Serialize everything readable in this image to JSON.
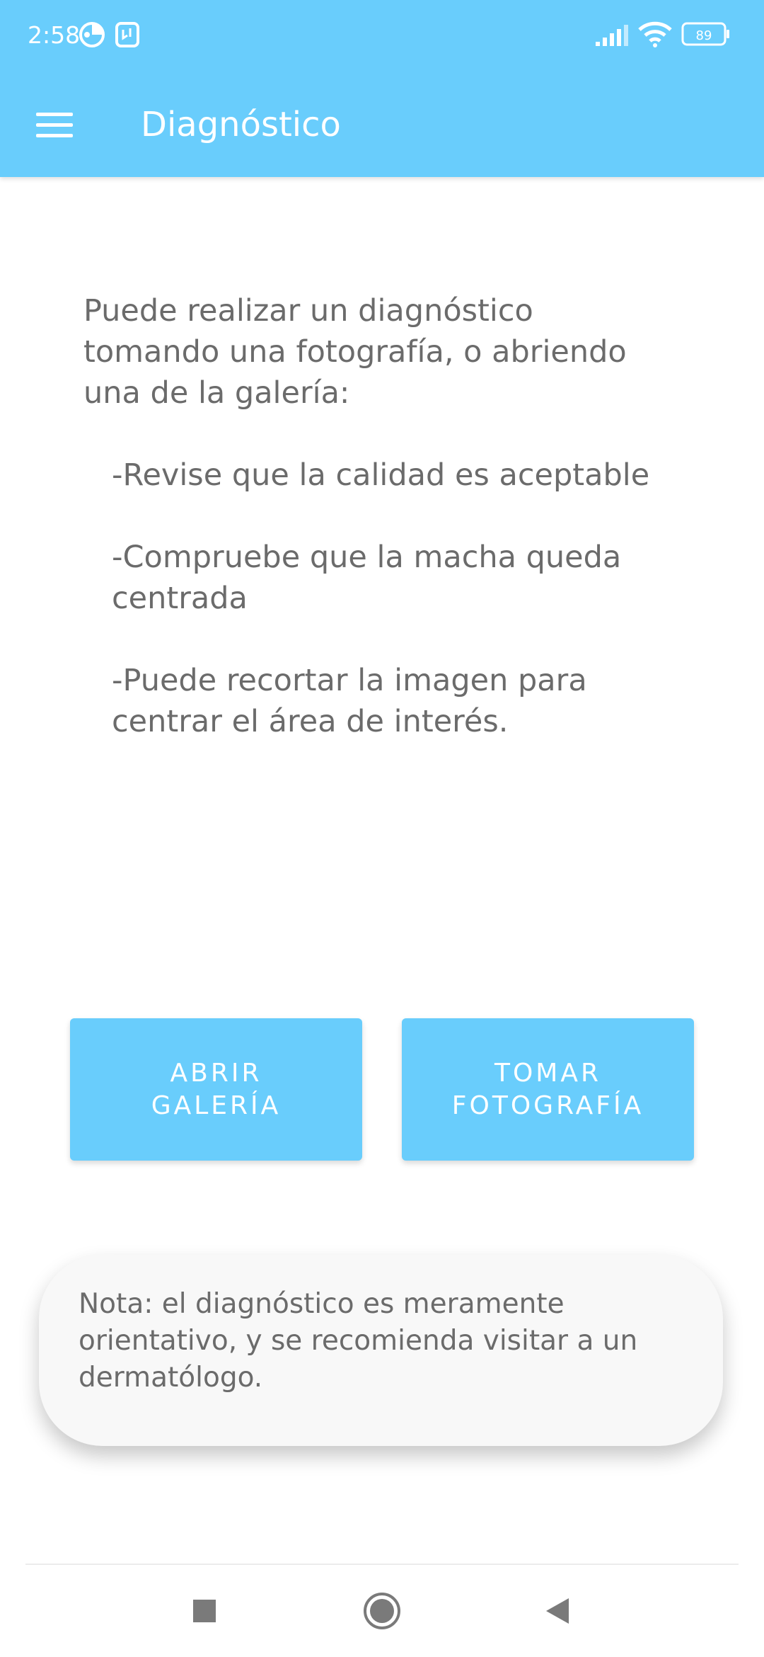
{
  "status_bar": {
    "time": "2:58",
    "battery": "89"
  },
  "app_bar": {
    "title": "Diagnóstico",
    "menu_icon": "hamburger-menu-icon"
  },
  "instructions": {
    "intro": "Puede realizar un diagnóstico\ntomando una fotografía, o abriendo\nuna de la galería:",
    "steps": [
      "-Revise que la calidad es aceptable",
      "-Compruebe que la macha queda\n centrada",
      "-Puede recortar la imagen para\ncentrar el área de interés."
    ]
  },
  "buttons": {
    "open_gallery": "ABRIR\nGALERÍA",
    "take_photo": "TOMAR\nFOTOGRAFÍA"
  },
  "note": {
    "text": "Nota: el diagnóstico es meramente orientativo, y se recomienda visitar a un dermatólogo."
  },
  "nav_bar": {
    "icons": [
      "recents-square-icon",
      "home-circle-icon",
      "back-triangle-icon"
    ]
  },
  "colors": {
    "accent": "#69cdfc",
    "text": "#6b6b6b",
    "card": "#f8f8f8"
  }
}
